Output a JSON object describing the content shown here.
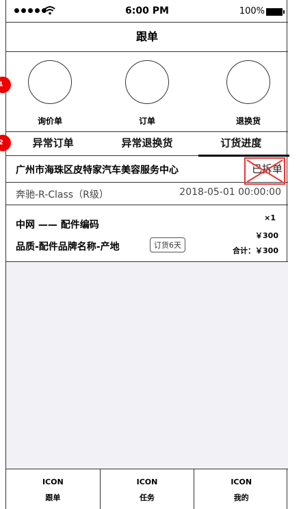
{
  "status_bar": {
    "time": "6:00 PM",
    "battery": "100%"
  },
  "header": {
    "title": "跟单"
  },
  "categories": [
    {
      "label": "询价单"
    },
    {
      "label": "订单"
    },
    {
      "label": "退换货"
    }
  ],
  "markers": [
    "I1",
    "I2"
  ],
  "tabs": [
    {
      "label": "异常订单"
    },
    {
      "label": "异常退换货"
    },
    {
      "label": "订货进度"
    }
  ],
  "order": {
    "store": "广州市海珠区皮特家汽车美容服务中心",
    "status": "已拆单",
    "vehicle": "奔驰-R-Class（R级）",
    "datetime": "2018-05-01 00:00:00",
    "part_code": "中网 —— 配件编码",
    "brand_line": "品质-配件品牌名称-产地",
    "badge": "订货6天",
    "quantity": "×1",
    "price": "￥300",
    "total": "合计：￥300"
  },
  "nav": [
    {
      "icon": "ICON",
      "label": "跟单"
    },
    {
      "icon": "ICON",
      "label": "任务"
    },
    {
      "icon": "ICON",
      "label": "我的"
    }
  ],
  "colors": {
    "marker": "#e00000",
    "highlight_box": "#e33333",
    "blank_area": "#f2f2f6"
  }
}
